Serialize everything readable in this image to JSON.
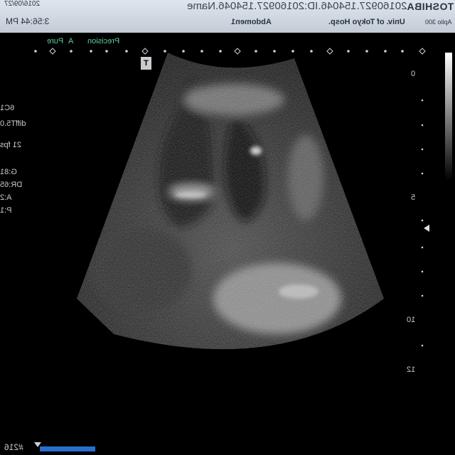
{
  "header": {
    "brand": "TOSHIBA",
    "model": "Aplio 300",
    "patient_line": "20160927.154046.ID:20160927.154046.Name",
    "institution": "Univ. of Tokyo Hosp.",
    "exam": "Abdomen1",
    "date": "2016/09/27",
    "time": "3:56:44 PM"
  },
  "modes": {
    "pure": "Pure",
    "a_mark": "A",
    "precision": "Precision"
  },
  "params": {
    "probe": "6C1",
    "preset": "diffT5.0",
    "frame_rate": "21 fps",
    "gain": "G:81",
    "dynamic_range": "DR:65",
    "a_value": "A:2",
    "p_value": "P:1"
  },
  "depth_scale": {
    "label_0": "0",
    "label_5": "5",
    "label_10": "10",
    "label_12": "12"
  },
  "orientation_marker": "T",
  "footer": {
    "frame_label": "#216"
  },
  "colors": {
    "header_bg": "#d4dbe3",
    "mode_text": "#5fd0a0",
    "footer_bar": "#2a6fd0"
  }
}
